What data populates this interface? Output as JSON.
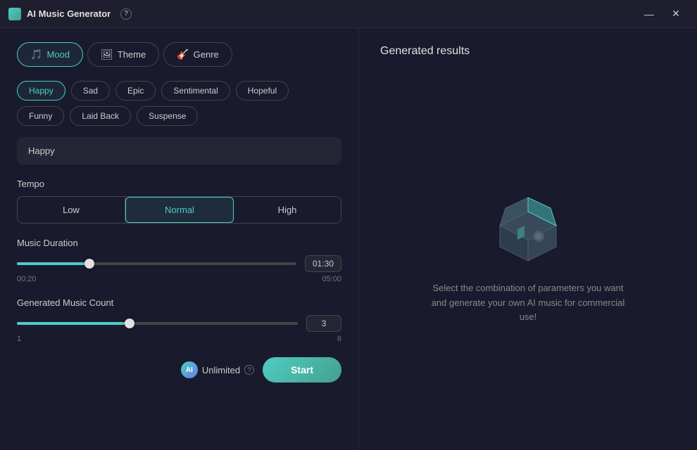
{
  "titlebar": {
    "title": "AI Music Generator",
    "help_label": "?",
    "minimize_label": "—",
    "close_label": "✕"
  },
  "tabs": [
    {
      "id": "mood",
      "label": "Mood",
      "icon": "🎵",
      "active": true
    },
    {
      "id": "theme",
      "label": "Theme",
      "icon": "🖼",
      "active": false
    },
    {
      "id": "genre",
      "label": "Genre",
      "icon": "🎸",
      "active": false
    }
  ],
  "mood_chips": [
    {
      "id": "happy",
      "label": "Happy",
      "selected": true
    },
    {
      "id": "sad",
      "label": "Sad",
      "selected": false
    },
    {
      "id": "epic",
      "label": "Epic",
      "selected": false
    },
    {
      "id": "sentimental",
      "label": "Sentimental",
      "selected": false
    },
    {
      "id": "hopeful",
      "label": "Hopeful",
      "selected": false
    },
    {
      "id": "funny",
      "label": "Funny",
      "selected": false
    },
    {
      "id": "laid-back",
      "label": "Laid Back",
      "selected": false
    },
    {
      "id": "suspense",
      "label": "Suspense",
      "selected": false
    }
  ],
  "selected_mood_display": "Happy",
  "tempo": {
    "label": "Tempo",
    "options": [
      {
        "id": "low",
        "label": "Low",
        "active": false
      },
      {
        "id": "normal",
        "label": "Normal",
        "active": true
      },
      {
        "id": "high",
        "label": "High",
        "active": false
      }
    ]
  },
  "music_duration": {
    "label": "Music Duration",
    "min_label": "00:20",
    "max_label": "05:00",
    "value_display": "01:30",
    "fill_percent": 26
  },
  "music_count": {
    "label": "Generated Music Count",
    "min_label": "1",
    "max_label": "6",
    "value_display": "3",
    "fill_percent": 40
  },
  "unlimited": {
    "label": "Unlimited",
    "icon_label": "AI"
  },
  "start_button": {
    "label": "Start"
  },
  "results_panel": {
    "title": "Generated results",
    "placeholder_text": "Select the combination of parameters you want and generate your own AI music for commercial use!"
  }
}
